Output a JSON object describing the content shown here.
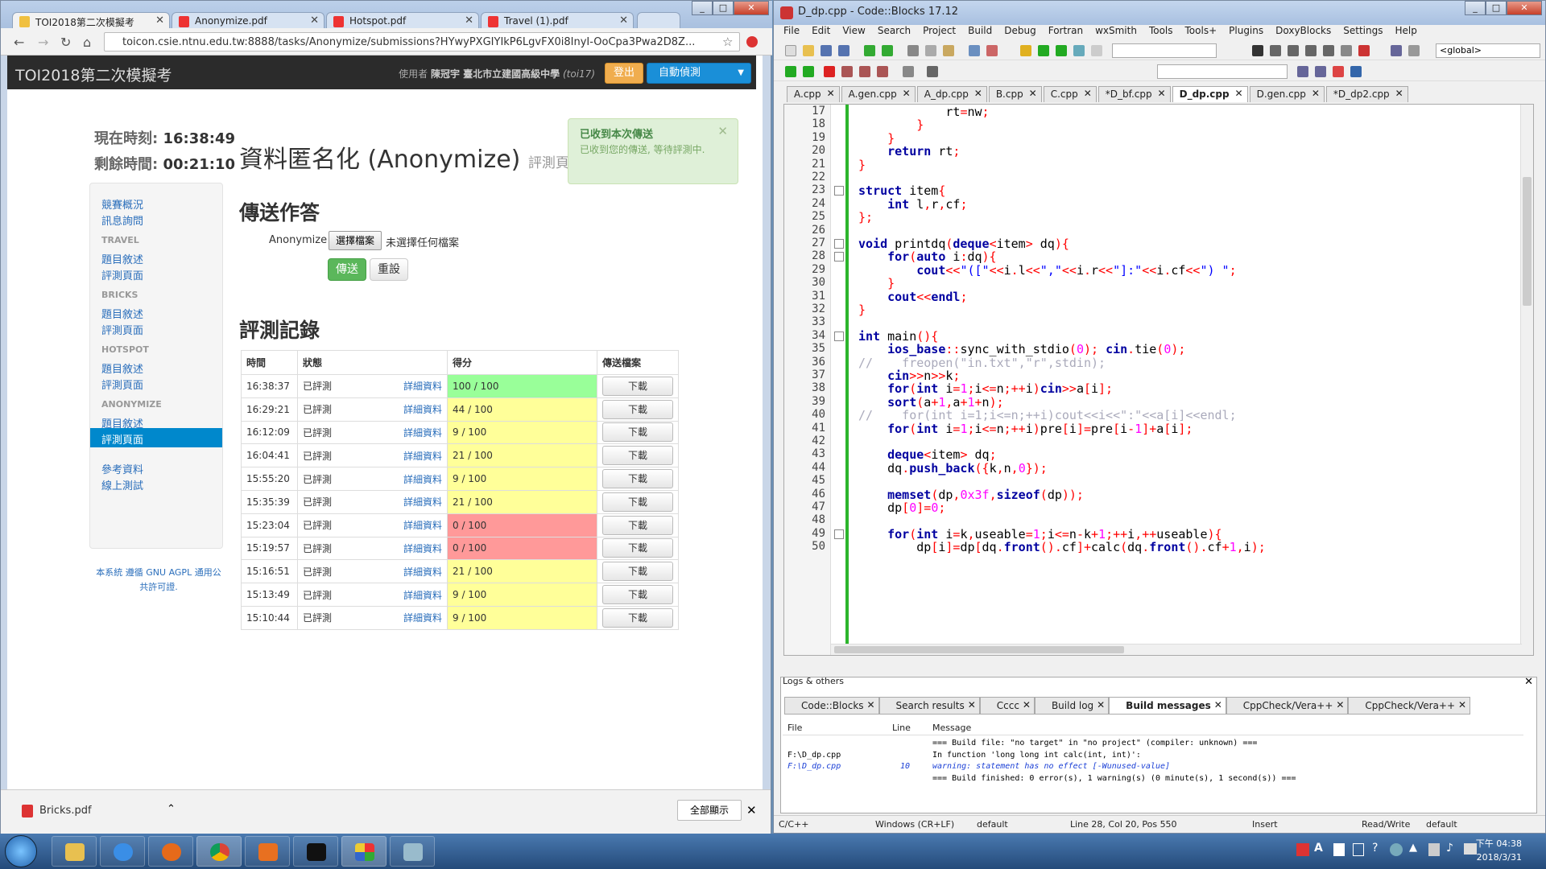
{
  "chrome": {
    "tabs": [
      "TOI2018第二次模擬考",
      "Anonymize.pdf",
      "Hotspot.pdf",
      "Travel (1).pdf"
    ],
    "url": "toicon.csie.ntnu.edu.tw:8888/tasks/Anonymize/submissions?HYwyPXGIYIkP6LgvFX0i8InyI-OoCpa3Pwa2D8Z...",
    "download_file": "Bricks.pdf",
    "show_all": "全部顯示"
  },
  "site": {
    "brand": "TOI2018第二次模擬考",
    "user_prefix": "使用者",
    "user_name": "陳冠宇 臺北市立建國高級中學",
    "user_id": "(toi17)",
    "logout": "登出",
    "autotest": "自動偵測",
    "clock_now_label": "現在時刻:",
    "clock_now": "16:38:49",
    "clock_left_label": "剩餘時間:",
    "clock_left": "00:21:10",
    "title": "資料匿名化 (Anonymize)",
    "title_small": "評測頁面",
    "alert_title": "已收到本次傳送",
    "alert_msg": "已收到您的傳送, 等待評測中.",
    "submit_heading": "傳送作答",
    "file_label": "Anonymize",
    "choose_file": "選擇檔案",
    "no_file": "未選擇任何檔案",
    "submit": "傳送",
    "reset": "重設",
    "history_heading": "評測記錄",
    "license": "本系統 遵循 GNU AGPL 通用公共許可證."
  },
  "sidebar": {
    "top": [
      "競賽概況",
      "訊息詢問"
    ],
    "sections": [
      {
        "name": "TRAVEL",
        "items": [
          "題目敘述",
          "評測頁面"
        ]
      },
      {
        "name": "BRICKS",
        "items": [
          "題目敘述",
          "評測頁面"
        ]
      },
      {
        "name": "HOTSPOT",
        "items": [
          "題目敘述",
          "評測頁面"
        ]
      },
      {
        "name": "ANONYMIZE",
        "items": [
          "題目敘述",
          "評測頁面"
        ]
      }
    ],
    "bottom": [
      "參考資料",
      "線上測試"
    ]
  },
  "table": {
    "headers": [
      "時間",
      "狀態",
      "得分",
      "傳送檔案"
    ],
    "detail": "詳細資料",
    "download": "下載",
    "rows": [
      {
        "time": "16:38:37",
        "status": "已評測",
        "score": "100 / 100",
        "color": "#99ff99"
      },
      {
        "time": "16:29:21",
        "status": "已評測",
        "score": "44 / 100",
        "color": "#ffff99"
      },
      {
        "time": "16:12:09",
        "status": "已評測",
        "score": "9 / 100",
        "color": "#ffff99"
      },
      {
        "time": "16:04:41",
        "status": "已評測",
        "score": "21 / 100",
        "color": "#ffff99"
      },
      {
        "time": "15:55:20",
        "status": "已評測",
        "score": "9 / 100",
        "color": "#ffff99"
      },
      {
        "time": "15:35:39",
        "status": "已評測",
        "score": "21 / 100",
        "color": "#ffff99"
      },
      {
        "time": "15:23:04",
        "status": "已評測",
        "score": "0 / 100",
        "color": "#ff9999"
      },
      {
        "time": "15:19:57",
        "status": "已評測",
        "score": "0 / 100",
        "color": "#ff9999"
      },
      {
        "time": "15:16:51",
        "status": "已評測",
        "score": "21 / 100",
        "color": "#ffff99"
      },
      {
        "time": "15:13:49",
        "status": "已評測",
        "score": "9 / 100",
        "color": "#ffff99"
      },
      {
        "time": "15:10:44",
        "status": "已評測",
        "score": "9 / 100",
        "color": "#ffff99"
      }
    ]
  },
  "codeblocks": {
    "title": "D_dp.cpp - Code::Blocks 17.12",
    "menu": [
      "File",
      "Edit",
      "View",
      "Search",
      "Project",
      "Build",
      "Debug",
      "Fortran",
      "wxSmith",
      "Tools",
      "Tools+",
      "Plugins",
      "DoxyBlocks",
      "Settings",
      "Help"
    ],
    "scope": "<global>",
    "tabs": [
      "A.cpp",
      "A.gen.cpp",
      "A_dp.cpp",
      "B.cpp",
      "C.cpp",
      "*D_bf.cpp",
      "D_dp.cpp",
      "D.gen.cpp",
      "*D_dp2.cpp"
    ],
    "active_tab": 6,
    "lines": [
      {
        "n": "17",
        "t": "            rt=nw;"
      },
      {
        "n": "18",
        "t": "        }"
      },
      {
        "n": "19",
        "t": "    }"
      },
      {
        "n": "20",
        "t": "    return rt;"
      },
      {
        "n": "21",
        "t": "}"
      },
      {
        "n": "22",
        "t": ""
      },
      {
        "n": "23",
        "t": "struct item{"
      },
      {
        "n": "24",
        "t": "    int l,r,cf;"
      },
      {
        "n": "25",
        "t": "};"
      },
      {
        "n": "26",
        "t": ""
      },
      {
        "n": "27",
        "t": "void printdq(deque<item> dq){"
      },
      {
        "n": "28",
        "t": "    for(auto i:dq){"
      },
      {
        "n": "29",
        "t": "        cout<<\"([\"<<i.l<<\",\"<<i.r<<\"]:\"<<i.cf<<\") \";"
      },
      {
        "n": "30",
        "t": "    }"
      },
      {
        "n": "31",
        "t": "    cout<<endl;"
      },
      {
        "n": "32",
        "t": "}"
      },
      {
        "n": "33",
        "t": ""
      },
      {
        "n": "34",
        "t": "int main(){"
      },
      {
        "n": "35",
        "t": "    ios_base::sync_with_stdio(0); cin.tie(0);"
      },
      {
        "n": "36",
        "t": "//    freopen(\"in.txt\",\"r\",stdin);"
      },
      {
        "n": "37",
        "t": "    cin>>n>>k;"
      },
      {
        "n": "38",
        "t": "    for(int i=1;i<=n;++i)cin>>a[i];"
      },
      {
        "n": "39",
        "t": "    sort(a+1,a+1+n);"
      },
      {
        "n": "40",
        "t": "//    for(int i=1;i<=n;++i)cout<<i<<\":\"<<a[i]<<endl;"
      },
      {
        "n": "41",
        "t": "    for(int i=1;i<=n;++i)pre[i]=pre[i-1]+a[i];"
      },
      {
        "n": "42",
        "t": ""
      },
      {
        "n": "43",
        "t": "    deque<item> dq;"
      },
      {
        "n": "44",
        "t": "    dq.push_back({k,n,0});"
      },
      {
        "n": "45",
        "t": ""
      },
      {
        "n": "46",
        "t": "    memset(dp,0x3f,sizeof(dp));"
      },
      {
        "n": "47",
        "t": "    dp[0]=0;"
      },
      {
        "n": "48",
        "t": ""
      },
      {
        "n": "49",
        "t": "    for(int i=k,useable=1;i<=n-k+1;++i,++useable){"
      },
      {
        "n": "50",
        "t": "        dp[i]=dp[dq.front().cf]+calc(dq.front().cf+1,i);"
      }
    ],
    "logs_title": "Logs & others",
    "log_tabs": [
      "Code::Blocks",
      "Search results",
      "Cccc",
      "Build log",
      "Build messages",
      "CppCheck/Vera++",
      "CppCheck/Vera++"
    ],
    "active_log_tab": 4,
    "msg_headers": [
      "File",
      "Line",
      "Message"
    ],
    "messages": [
      {
        "file": "",
        "line": "",
        "msg": "=== Build file: \"no target\" in \"no project\" (compiler: unknown) ===",
        "warn": false
      },
      {
        "file": "F:\\D_dp.cpp",
        "line": "",
        "msg": "In function 'long long int calc(int, int)':",
        "warn": false
      },
      {
        "file": "F:\\D_dp.cpp",
        "line": "10",
        "msg": "warning: statement has no effect [-Wunused-value]",
        "warn": true
      },
      {
        "file": "",
        "line": "",
        "msg": "=== Build finished: 0 error(s), 1 warning(s) (0 minute(s), 1 second(s)) ===",
        "warn": false
      }
    ],
    "status": [
      "C/C++",
      "Windows (CR+LF)",
      "default",
      "Line 28, Col 20, Pos 550",
      "Insert",
      "Read/Write",
      "default"
    ]
  },
  "taskbar": {
    "time": "下午 04:38",
    "date": "2018/3/31"
  }
}
